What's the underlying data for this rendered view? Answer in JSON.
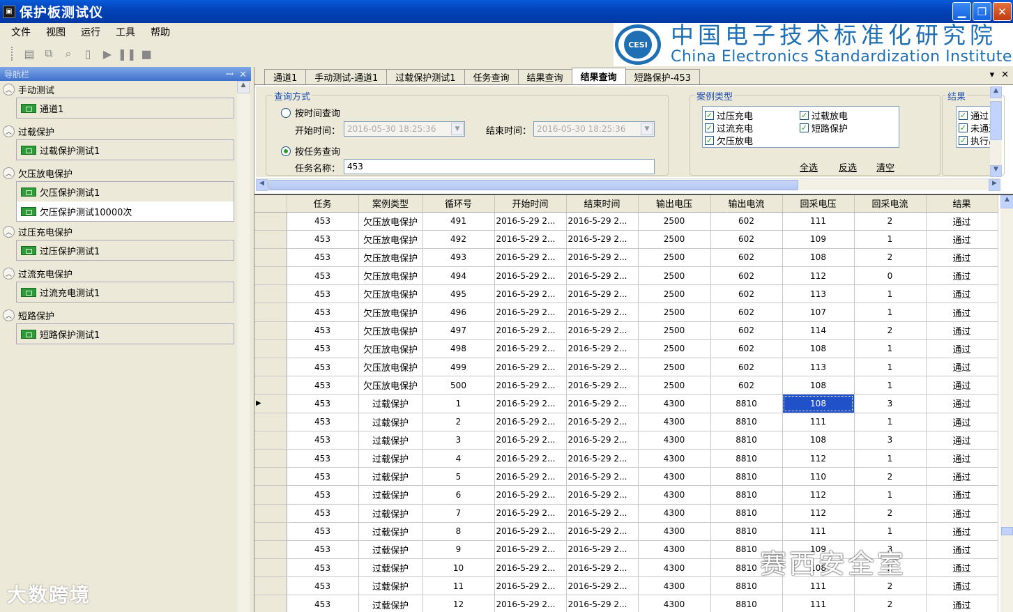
{
  "window": {
    "title": "保护板测试仪"
  },
  "menu": [
    "文件",
    "视图",
    "运行",
    "工具",
    "帮助"
  ],
  "toolbar_icons": [
    "save-icon",
    "copy-window-icon",
    "search-icon",
    "clipboard-icon",
    "play-icon",
    "pause-icon",
    "stop-icon"
  ],
  "banner": {
    "logo_text": "CESI",
    "cn": "中国电子技术标准化研究院",
    "en": "China Electronics Standardization Institute"
  },
  "nav": {
    "title": "导航栏",
    "groups": [
      {
        "label": "手动测试",
        "items": [
          "通道1"
        ]
      },
      {
        "label": "过载保护",
        "items": [
          "过载保护测试1"
        ]
      },
      {
        "label": "欠压放电保护",
        "items": [
          "欠压保护测试1",
          "欠压保护测试10000次"
        ]
      },
      {
        "label": "过压充电保护",
        "items": [
          "过压保护测试1"
        ]
      },
      {
        "label": "过流充电保护",
        "items": [
          "过流充电测试1"
        ]
      },
      {
        "label": "短路保护",
        "items": [
          "短路保护测试1"
        ]
      }
    ]
  },
  "tabs": [
    "通道1",
    "手动测试-通道1",
    "过载保护测试1",
    "任务查询",
    "结果查询",
    "结果查询",
    "短路保护-453"
  ],
  "query": {
    "section_label": "查询方式",
    "by_time_label": "按时间查询",
    "start_label": "开始时间：",
    "start_value": "2016-05-30 18:25:36",
    "end_label": "结束时间：",
    "end_value": "2016-05-30 18:25:36",
    "by_task_label": "按任务查询",
    "task_name_label": "任务名称：",
    "task_name_value": "453",
    "case_type_label": "案例类型",
    "case_types": [
      "过压充电",
      "过载放电",
      "过流充电",
      "短路保护",
      "欠压放电"
    ],
    "select_all": "全选",
    "invert": "反选",
    "clear": "清空",
    "result_label": "结果",
    "results": [
      "通过",
      "未通过",
      "执行出"
    ]
  },
  "grid": {
    "columns": [
      "任务",
      "案例类型",
      "循环号",
      "开始时间",
      "结束时间",
      "输出电压",
      "输出电流",
      "回采电压",
      "回采电流",
      "结果"
    ],
    "rows": [
      [
        "453",
        "欠压放电保护",
        "491",
        "2016-5-29 2...",
        "2016-5-29 2...",
        "2500",
        "602",
        "111",
        "2",
        "通过"
      ],
      [
        "453",
        "欠压放电保护",
        "492",
        "2016-5-29 2...",
        "2016-5-29 2...",
        "2500",
        "602",
        "109",
        "1",
        "通过"
      ],
      [
        "453",
        "欠压放电保护",
        "493",
        "2016-5-29 2...",
        "2016-5-29 2...",
        "2500",
        "602",
        "108",
        "2",
        "通过"
      ],
      [
        "453",
        "欠压放电保护",
        "494",
        "2016-5-29 2...",
        "2016-5-29 2...",
        "2500",
        "602",
        "112",
        "0",
        "通过"
      ],
      [
        "453",
        "欠压放电保护",
        "495",
        "2016-5-29 2...",
        "2016-5-29 2...",
        "2500",
        "602",
        "113",
        "1",
        "通过"
      ],
      [
        "453",
        "欠压放电保护",
        "496",
        "2016-5-29 2...",
        "2016-5-29 2...",
        "2500",
        "602",
        "107",
        "1",
        "通过"
      ],
      [
        "453",
        "欠压放电保护",
        "497",
        "2016-5-29 2...",
        "2016-5-29 2...",
        "2500",
        "602",
        "114",
        "2",
        "通过"
      ],
      [
        "453",
        "欠压放电保护",
        "498",
        "2016-5-29 2...",
        "2016-5-29 2...",
        "2500",
        "602",
        "108",
        "1",
        "通过"
      ],
      [
        "453",
        "欠压放电保护",
        "499",
        "2016-5-29 2...",
        "2016-5-29 2...",
        "2500",
        "602",
        "113",
        "1",
        "通过"
      ],
      [
        "453",
        "欠压放电保护",
        "500",
        "2016-5-29 2...",
        "2016-5-29 2...",
        "2500",
        "602",
        "108",
        "1",
        "通过"
      ],
      [
        "453",
        "过载保护",
        "1",
        "2016-5-29 2...",
        "2016-5-29 2...",
        "4300",
        "8810",
        "108",
        "3",
        "通过"
      ],
      [
        "453",
        "过载保护",
        "2",
        "2016-5-29 2...",
        "2016-5-29 2...",
        "4300",
        "8810",
        "111",
        "1",
        "通过"
      ],
      [
        "453",
        "过载保护",
        "3",
        "2016-5-29 2...",
        "2016-5-29 2...",
        "4300",
        "8810",
        "108",
        "3",
        "通过"
      ],
      [
        "453",
        "过载保护",
        "4",
        "2016-5-29 2...",
        "2016-5-29 2...",
        "4300",
        "8810",
        "112",
        "1",
        "通过"
      ],
      [
        "453",
        "过载保护",
        "5",
        "2016-5-29 2...",
        "2016-5-29 2...",
        "4300",
        "8810",
        "110",
        "2",
        "通过"
      ],
      [
        "453",
        "过载保护",
        "6",
        "2016-5-29 2...",
        "2016-5-29 2...",
        "4300",
        "8810",
        "112",
        "1",
        "通过"
      ],
      [
        "453",
        "过载保护",
        "7",
        "2016-5-29 2...",
        "2016-5-29 2...",
        "4300",
        "8810",
        "112",
        "2",
        "通过"
      ],
      [
        "453",
        "过载保护",
        "8",
        "2016-5-29 2...",
        "2016-5-29 2...",
        "4300",
        "8810",
        "111",
        "1",
        "通过"
      ],
      [
        "453",
        "过载保护",
        "9",
        "2016-5-29 2...",
        "2016-5-29 2...",
        "4300",
        "8810",
        "109",
        "3",
        "通过"
      ],
      [
        "453",
        "过载保护",
        "10",
        "2016-5-29 2...",
        "2016-5-29 2...",
        "4300",
        "8810",
        "108",
        "2",
        "通过"
      ],
      [
        "453",
        "过载保护",
        "11",
        "2016-5-29 2...",
        "2016-5-29 2...",
        "4300",
        "8810",
        "111",
        "2",
        "通过"
      ],
      [
        "453",
        "过载保护",
        "12",
        "2016-5-29 2...",
        "2016-5-29 2...",
        "4300",
        "8810",
        "111",
        "2",
        "通过"
      ]
    ],
    "current_row": 10,
    "selected_cell_col": 7
  },
  "watermarks": {
    "left": "大数跨境",
    "right": "赛西安全室"
  },
  "colors": {
    "title_bar": "#0342b8",
    "selection": "#2151c8",
    "brand_blue": "#1f6fb5",
    "nav_header": "#3f71cc"
  }
}
